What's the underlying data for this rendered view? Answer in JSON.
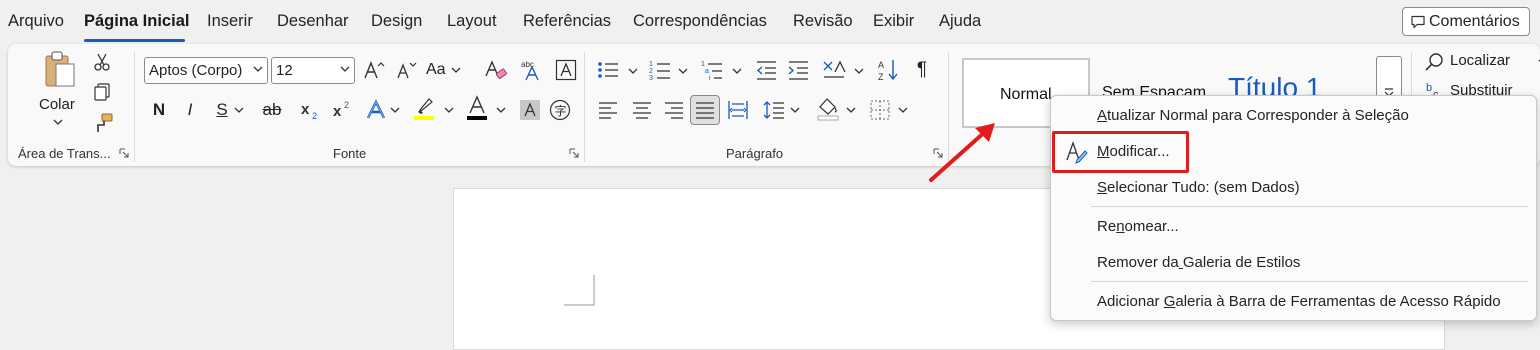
{
  "menubar": {
    "tabs": [
      {
        "label": "Arquivo"
      },
      {
        "label": "Página Inicial",
        "active": true
      },
      {
        "label": "Inserir"
      },
      {
        "label": "Desenhar"
      },
      {
        "label": "Design"
      },
      {
        "label": "Layout"
      },
      {
        "label": "Referências"
      },
      {
        "label": "Correspondências"
      },
      {
        "label": "Revisão"
      },
      {
        "label": "Exibir"
      },
      {
        "label": "Ajuda"
      }
    ],
    "comments_label": "Comentários"
  },
  "ribbon": {
    "clipboard": {
      "paste_label": "Colar",
      "group_label": "Área de Trans..."
    },
    "font": {
      "font_name": "Aptos (Corpo)",
      "font_size": "12",
      "change_case_label": "Aa",
      "group_label": "Fonte",
      "highlight_color": "#ffff00",
      "font_color": "#000000"
    },
    "paragraph": {
      "group_label": "Parágrafo"
    },
    "styles": {
      "normal": "Normal",
      "no_spacing": "Sem Espaçam...",
      "title1": "Título 1"
    },
    "editing": {
      "find_label": "Localizar",
      "replace_label": "Substituir"
    }
  },
  "context_menu": {
    "items": [
      {
        "label": "Atualizar Normal para Corresponder à Seleção",
        "mnemonic_index": 0
      },
      {
        "label": "Modificar...",
        "mnemonic_index": 0
      },
      {
        "label": "Selecionar Tudo: (sem Dados)",
        "mnemonic_index": 0
      },
      {
        "label": "Renomear...",
        "mnemonic_index": 2
      },
      {
        "label": "Remover da Galeria de Estilos",
        "mnemonic_index": 10
      },
      {
        "label": "Adicionar Galeria à Barra de Ferramentas de Acesso Rápido",
        "mnemonic_index": 10
      }
    ]
  },
  "colors": {
    "accent": "#185abd",
    "annotation_red": "#e21b1b"
  }
}
